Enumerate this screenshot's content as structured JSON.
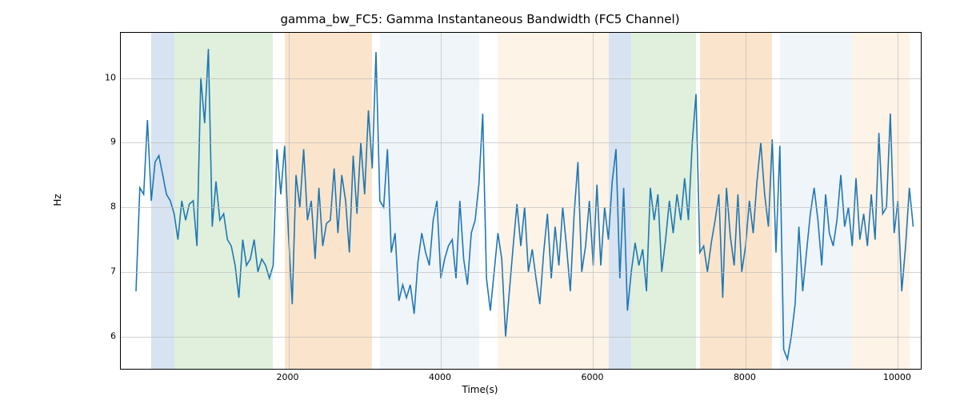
{
  "chart_data": {
    "type": "line",
    "title": "gamma_bw_FC5: Gamma Instantaneous Bandwidth (FC5 Channel)",
    "xlabel": "Time(s)",
    "ylabel": "Hz",
    "xlim": [
      -200,
      10300
    ],
    "ylim": [
      5.5,
      10.7
    ],
    "xticks": [
      2000,
      4000,
      6000,
      8000,
      10000
    ],
    "yticks": [
      6,
      7,
      8,
      9,
      10
    ],
    "bands": [
      {
        "start": 200,
        "end": 500,
        "color": "#b7cce3"
      },
      {
        "start": 500,
        "end": 1800,
        "color": "#c6e3bf"
      },
      {
        "start": 1950,
        "end": 3100,
        "color": "#f6cfa2"
      },
      {
        "start": 3200,
        "end": 4500,
        "color": "#e4ecf5"
      },
      {
        "start": 4750,
        "end": 6200,
        "color": "#fbe9d3"
      },
      {
        "start": 6200,
        "end": 6500,
        "color": "#b7cce3"
      },
      {
        "start": 6500,
        "end": 7350,
        "color": "#c6e3bf"
      },
      {
        "start": 7400,
        "end": 8350,
        "color": "#f6cfa2"
      },
      {
        "start": 8450,
        "end": 9400,
        "color": "#e4ecf5"
      },
      {
        "start": 9400,
        "end": 10150,
        "color": "#fbe9d3"
      }
    ],
    "line_color": "#1f77b4",
    "x": [
      0,
      50,
      100,
      150,
      200,
      250,
      300,
      350,
      400,
      450,
      500,
      550,
      600,
      650,
      700,
      750,
      800,
      850,
      900,
      950,
      1000,
      1050,
      1100,
      1150,
      1200,
      1250,
      1300,
      1350,
      1400,
      1450,
      1500,
      1550,
      1600,
      1650,
      1700,
      1750,
      1800,
      1850,
      1900,
      1950,
      2000,
      2050,
      2100,
      2150,
      2200,
      2250,
      2300,
      2350,
      2400,
      2450,
      2500,
      2550,
      2600,
      2650,
      2700,
      2750,
      2800,
      2850,
      2900,
      2950,
      3000,
      3050,
      3100,
      3150,
      3200,
      3250,
      3300,
      3350,
      3400,
      3450,
      3500,
      3550,
      3600,
      3650,
      3700,
      3750,
      3800,
      3850,
      3900,
      3950,
      4000,
      4050,
      4100,
      4150,
      4200,
      4250,
      4300,
      4350,
      4400,
      4450,
      4500,
      4550,
      4600,
      4650,
      4700,
      4750,
      4800,
      4850,
      4900,
      4950,
      5000,
      5050,
      5100,
      5150,
      5200,
      5250,
      5300,
      5350,
      5400,
      5450,
      5500,
      5550,
      5600,
      5650,
      5700,
      5750,
      5800,
      5850,
      5900,
      5950,
      6000,
      6050,
      6100,
      6150,
      6200,
      6250,
      6300,
      6350,
      6400,
      6450,
      6500,
      6550,
      6600,
      6650,
      6700,
      6750,
      6800,
      6850,
      6900,
      6950,
      7000,
      7050,
      7100,
      7150,
      7200,
      7250,
      7300,
      7350,
      7400,
      7450,
      7500,
      7550,
      7600,
      7650,
      7700,
      7750,
      7800,
      7850,
      7900,
      7950,
      8000,
      8050,
      8100,
      8150,
      8200,
      8250,
      8300,
      8350,
      8400,
      8450,
      8500,
      8550,
      8600,
      8650,
      8700,
      8750,
      8800,
      8850,
      8900,
      8950,
      9000,
      9050,
      9100,
      9150,
      9200,
      9250,
      9300,
      9350,
      9400,
      9450,
      9500,
      9550,
      9600,
      9650,
      9700,
      9750,
      9800,
      9850,
      9900,
      9950,
      10000,
      10050,
      10100,
      10150,
      10200
    ],
    "y": [
      6.7,
      8.3,
      8.2,
      9.35,
      8.1,
      8.7,
      8.8,
      8.5,
      8.2,
      8.1,
      7.9,
      7.5,
      8.1,
      7.8,
      8.05,
      8.1,
      7.4,
      10.0,
      9.3,
      10.45,
      7.7,
      8.4,
      7.8,
      7.9,
      7.5,
      7.4,
      7.1,
      6.6,
      7.5,
      7.1,
      7.2,
      7.5,
      7.0,
      7.2,
      7.1,
      6.9,
      7.1,
      8.9,
      8.2,
      8.95,
      7.6,
      6.5,
      8.5,
      8.0,
      8.9,
      7.8,
      8.1,
      7.2,
      8.3,
      7.4,
      7.75,
      7.8,
      8.6,
      7.6,
      8.5,
      8.1,
      7.3,
      8.8,
      7.9,
      9.0,
      8.2,
      9.5,
      8.6,
      10.4,
      8.1,
      8.0,
      8.9,
      7.3,
      7.6,
      6.55,
      6.8,
      6.6,
      6.8,
      6.35,
      7.15,
      7.6,
      7.3,
      7.1,
      7.8,
      8.1,
      6.9,
      7.2,
      7.4,
      7.5,
      6.9,
      8.1,
      7.2,
      6.8,
      7.6,
      7.8,
      8.35,
      9.45,
      6.9,
      6.4,
      7.0,
      7.6,
      7.2,
      6.0,
      6.7,
      7.4,
      8.05,
      7.4,
      8.0,
      7.0,
      7.35,
      6.9,
      6.5,
      7.3,
      7.9,
      6.9,
      7.7,
      7.1,
      8.0,
      7.4,
      6.7,
      7.9,
      8.7,
      7.0,
      7.4,
      8.1,
      7.1,
      8.35,
      7.1,
      8.0,
      7.5,
      8.4,
      8.9,
      6.9,
      8.3,
      6.4,
      7.0,
      7.45,
      7.1,
      7.35,
      6.7,
      8.3,
      7.8,
      8.2,
      7.0,
      7.5,
      8.1,
      7.6,
      8.2,
      7.8,
      8.45,
      7.8,
      9.0,
      9.75,
      7.3,
      7.4,
      7.0,
      7.45,
      7.8,
      8.2,
      6.6,
      8.3,
      7.55,
      7.1,
      8.2,
      7.0,
      7.4,
      8.1,
      7.6,
      8.4,
      9.0,
      8.2,
      7.7,
      9.05,
      7.3,
      8.95,
      5.8,
      5.65,
      6.0,
      6.5,
      7.7,
      6.7,
      7.3,
      7.9,
      8.3,
      7.8,
      7.1,
      8.2,
      7.6,
      7.4,
      7.8,
      8.5,
      7.7,
      8.0,
      7.4,
      8.45,
      7.5,
      7.9,
      7.4,
      8.2,
      7.5,
      9.15,
      7.9,
      8.0,
      9.45,
      7.6,
      8.1,
      6.7,
      7.4,
      8.3,
      7.7
    ]
  }
}
